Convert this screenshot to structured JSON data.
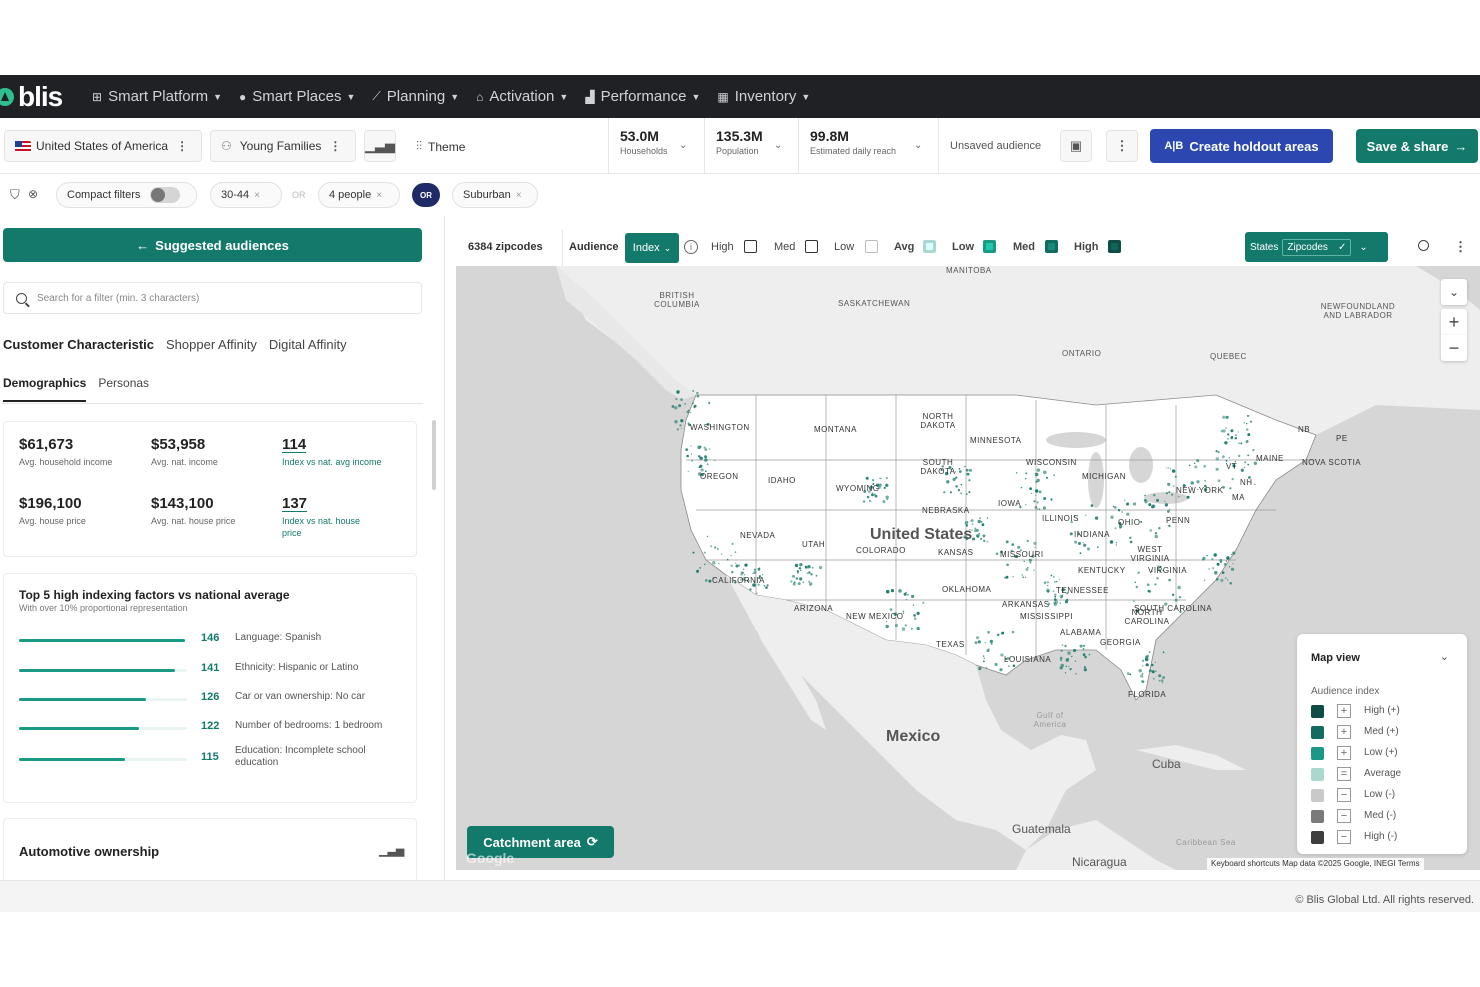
{
  "nav": {
    "logo": "blis",
    "items": [
      {
        "label": "Smart Platform",
        "icon": "grid-icon"
      },
      {
        "label": "Smart Places",
        "icon": "compass-icon"
      },
      {
        "label": "Planning",
        "icon": "chart-line-icon"
      },
      {
        "label": "Activation",
        "icon": "home-icon"
      },
      {
        "label": "Performance",
        "icon": "bar-chart-icon"
      },
      {
        "label": "Inventory",
        "icon": "grid-blocks-icon"
      }
    ]
  },
  "toolbar": {
    "country": "United States of America",
    "audience": "Young Families",
    "theme": "Theme",
    "households_value": "53.0M",
    "households_label": "Households",
    "population_value": "135.3M",
    "population_label": "Population",
    "reach_value": "99.8M",
    "reach_label": "Estimated daily reach",
    "audience_status": "Unsaved audience",
    "holdout_button": "Create holdout areas",
    "holdout_prefix": "A|B",
    "save_button": "Save & share"
  },
  "filters": {
    "compact_label": "Compact filters",
    "chip1": "30-44",
    "or1": "OR",
    "chip2": "4 people",
    "or2": "OR",
    "chip3": "Suburban"
  },
  "left": {
    "suggest_button": "Suggested audiences",
    "search_placeholder": "Search for a filter (min. 3 characters)",
    "tabs": [
      "Customer Characteristic",
      "Shopper Affinity",
      "Digital Affinity"
    ],
    "subtabs": [
      "Demographics",
      "Personas"
    ],
    "metrics": [
      {
        "value": "$61,673",
        "label": "Avg. household income"
      },
      {
        "value": "$53,958",
        "label": "Avg. nat. income"
      },
      {
        "value": "114",
        "label": "Index vs nat. avg income"
      },
      {
        "value": "$196,100",
        "label": "Avg. house price"
      },
      {
        "value": "$143,100",
        "label": "Avg. nat. house price"
      },
      {
        "value": "137",
        "label": "Index vs nat. house price"
      }
    ],
    "factors_title": "Top 5 high indexing factors vs national average",
    "factors_sub": "With over 10% proportional representation",
    "factors": [
      {
        "value": 146,
        "label": "Language: Spanish"
      },
      {
        "value": 141,
        "label": "Ethnicity: Hispanic or Latino"
      },
      {
        "value": 126,
        "label": "Car or van ownership: No car"
      },
      {
        "value": 122,
        "label": "Number of bedrooms: 1 bedroom"
      },
      {
        "value": 115,
        "label": "Education: Incomplete school education"
      }
    ],
    "auto_title": "Automotive ownership"
  },
  "map": {
    "zip_count": "6384 zipcodes",
    "audience_label": "Audience",
    "index_label": "Index",
    "chk_high": "High",
    "chk_med": "Med",
    "chk_low": "Low",
    "chk_avg": "Avg",
    "chk_low2": "Low",
    "chk_med2": "Med",
    "chk_high2": "High",
    "states_label": "States",
    "zipcodes_label": "Zipcodes",
    "catchment_button": "Catchment area",
    "legend_title": "Map view",
    "legend_sub": "Audience index",
    "legend": [
      {
        "label": "High (+)",
        "color": "#0e4d45",
        "sign": "+"
      },
      {
        "label": "Med (+)",
        "color": "#116b5f",
        "sign": "+"
      },
      {
        "label": "Low (+)",
        "color": "#1a9a85",
        "sign": "+"
      },
      {
        "label": "Average",
        "color": "#a9d8cf",
        "sign": "="
      },
      {
        "label": "Low (-)",
        "color": "#c9c9c9",
        "sign": "−"
      },
      {
        "label": "Med (-)",
        "color": "#7a7a7a",
        "sign": "−"
      },
      {
        "label": "High (-)",
        "color": "#3e3e3e",
        "sign": "−"
      }
    ],
    "attribution": "Keyboard shortcuts   Map data ©2025 Google, INEGI   Terms",
    "google": "Google",
    "labels": {
      "us": "United States",
      "mexico": "Mexico",
      "cuba": "Cuba",
      "guatemala": "Guatemala",
      "nicaragua": "Nicaragua",
      "gulf": "Gulf of America",
      "caribbean": "Caribbean Sea",
      "bc": "BRITISH COLUMBIA",
      "sask": "SASKATCHEWAN",
      "manitoba": "MANITOBA",
      "ontario": "ONTARIO",
      "quebec": "QUEBEC",
      "nfl": "NEWFOUNDLAND AND LABRADOR",
      "nb": "NB",
      "pe": "PE",
      "ns": "NOVA SCOTIA",
      "wa": "WASHINGTON",
      "mt": "MONTANA",
      "nd": "NORTH DAKOTA",
      "mn": "MINNESOTA",
      "or": "OREGON",
      "id": "IDAHO",
      "wy": "WYOMING",
      "sd": "SOUTH DAKOTA",
      "wi": "WISCONSIN",
      "mi": "MICHIGAN",
      "ny": "NEW YORK",
      "ne": "NEBRASKA",
      "ia": "IOWA",
      "nv": "NEVADA",
      "ut": "UTAH",
      "co": "COLORADO",
      "ks": "KANSAS",
      "il": "ILLINOIS",
      "in": "INDIANA",
      "oh": "OHIO",
      "pa": "PENN",
      "ca": "CALIFORNIA",
      "mo": "MISSOURI",
      "ky": "KENTUCKY",
      "wv": "WEST VIRGINIA",
      "va": "VIRGINIA",
      "az": "ARIZONA",
      "nm": "NEW MEXICO",
      "ok": "OKLAHOMA",
      "ar": "ARKANSAS",
      "tn": "TENNESSEE",
      "nc": "NORTH CAROLINA",
      "sc": "SOUTH CAROLINA",
      "tx": "TEXAS",
      "ms": "MISSISSIPPI",
      "al": "ALABAMA",
      "ga": "GEORGIA",
      "la": "LOUISIANA",
      "fl": "FLORIDA",
      "me": "MAINE",
      "vt": "VT",
      "nh": "NH",
      "ma": "MA"
    }
  },
  "footer": "© Blis Global Ltd. All rights reserved."
}
